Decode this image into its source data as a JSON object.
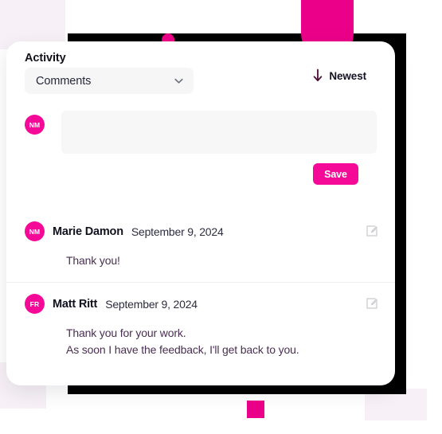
{
  "theme": {
    "accent_pink": "#f50a97",
    "deco_pink": "#eb0089",
    "deco_lavender": "#f7f1f7",
    "deco_black": "#000000",
    "card_background": "#ffffff",
    "field_background": "#f6f6f7",
    "body_text": "#4a2f52",
    "arrow_purple": "#4b0d33"
  },
  "panel": {
    "title": "Activity",
    "filter": {
      "selected": "Comments",
      "options": [
        "Comments"
      ],
      "chevron_icon": "chevron-down-icon"
    },
    "sort": {
      "label": "Newest",
      "direction_icon": "arrow-down-icon"
    }
  },
  "composer": {
    "avatar_initials": "NM",
    "value": "",
    "placeholder": "",
    "save_label": "Save"
  },
  "comments": [
    {
      "avatar_initials": "NM",
      "author": "Marie Damon",
      "date": "September 9, 2024",
      "body": "Thank you!",
      "edit_icon": "edit-icon"
    },
    {
      "avatar_initials": "FR",
      "author": "Matt Ritt",
      "date": "September 9, 2024",
      "body": "Thank you for your work.\nAs soon I have the feedback, I'll get back to you.",
      "edit_icon": "edit-icon"
    }
  ]
}
